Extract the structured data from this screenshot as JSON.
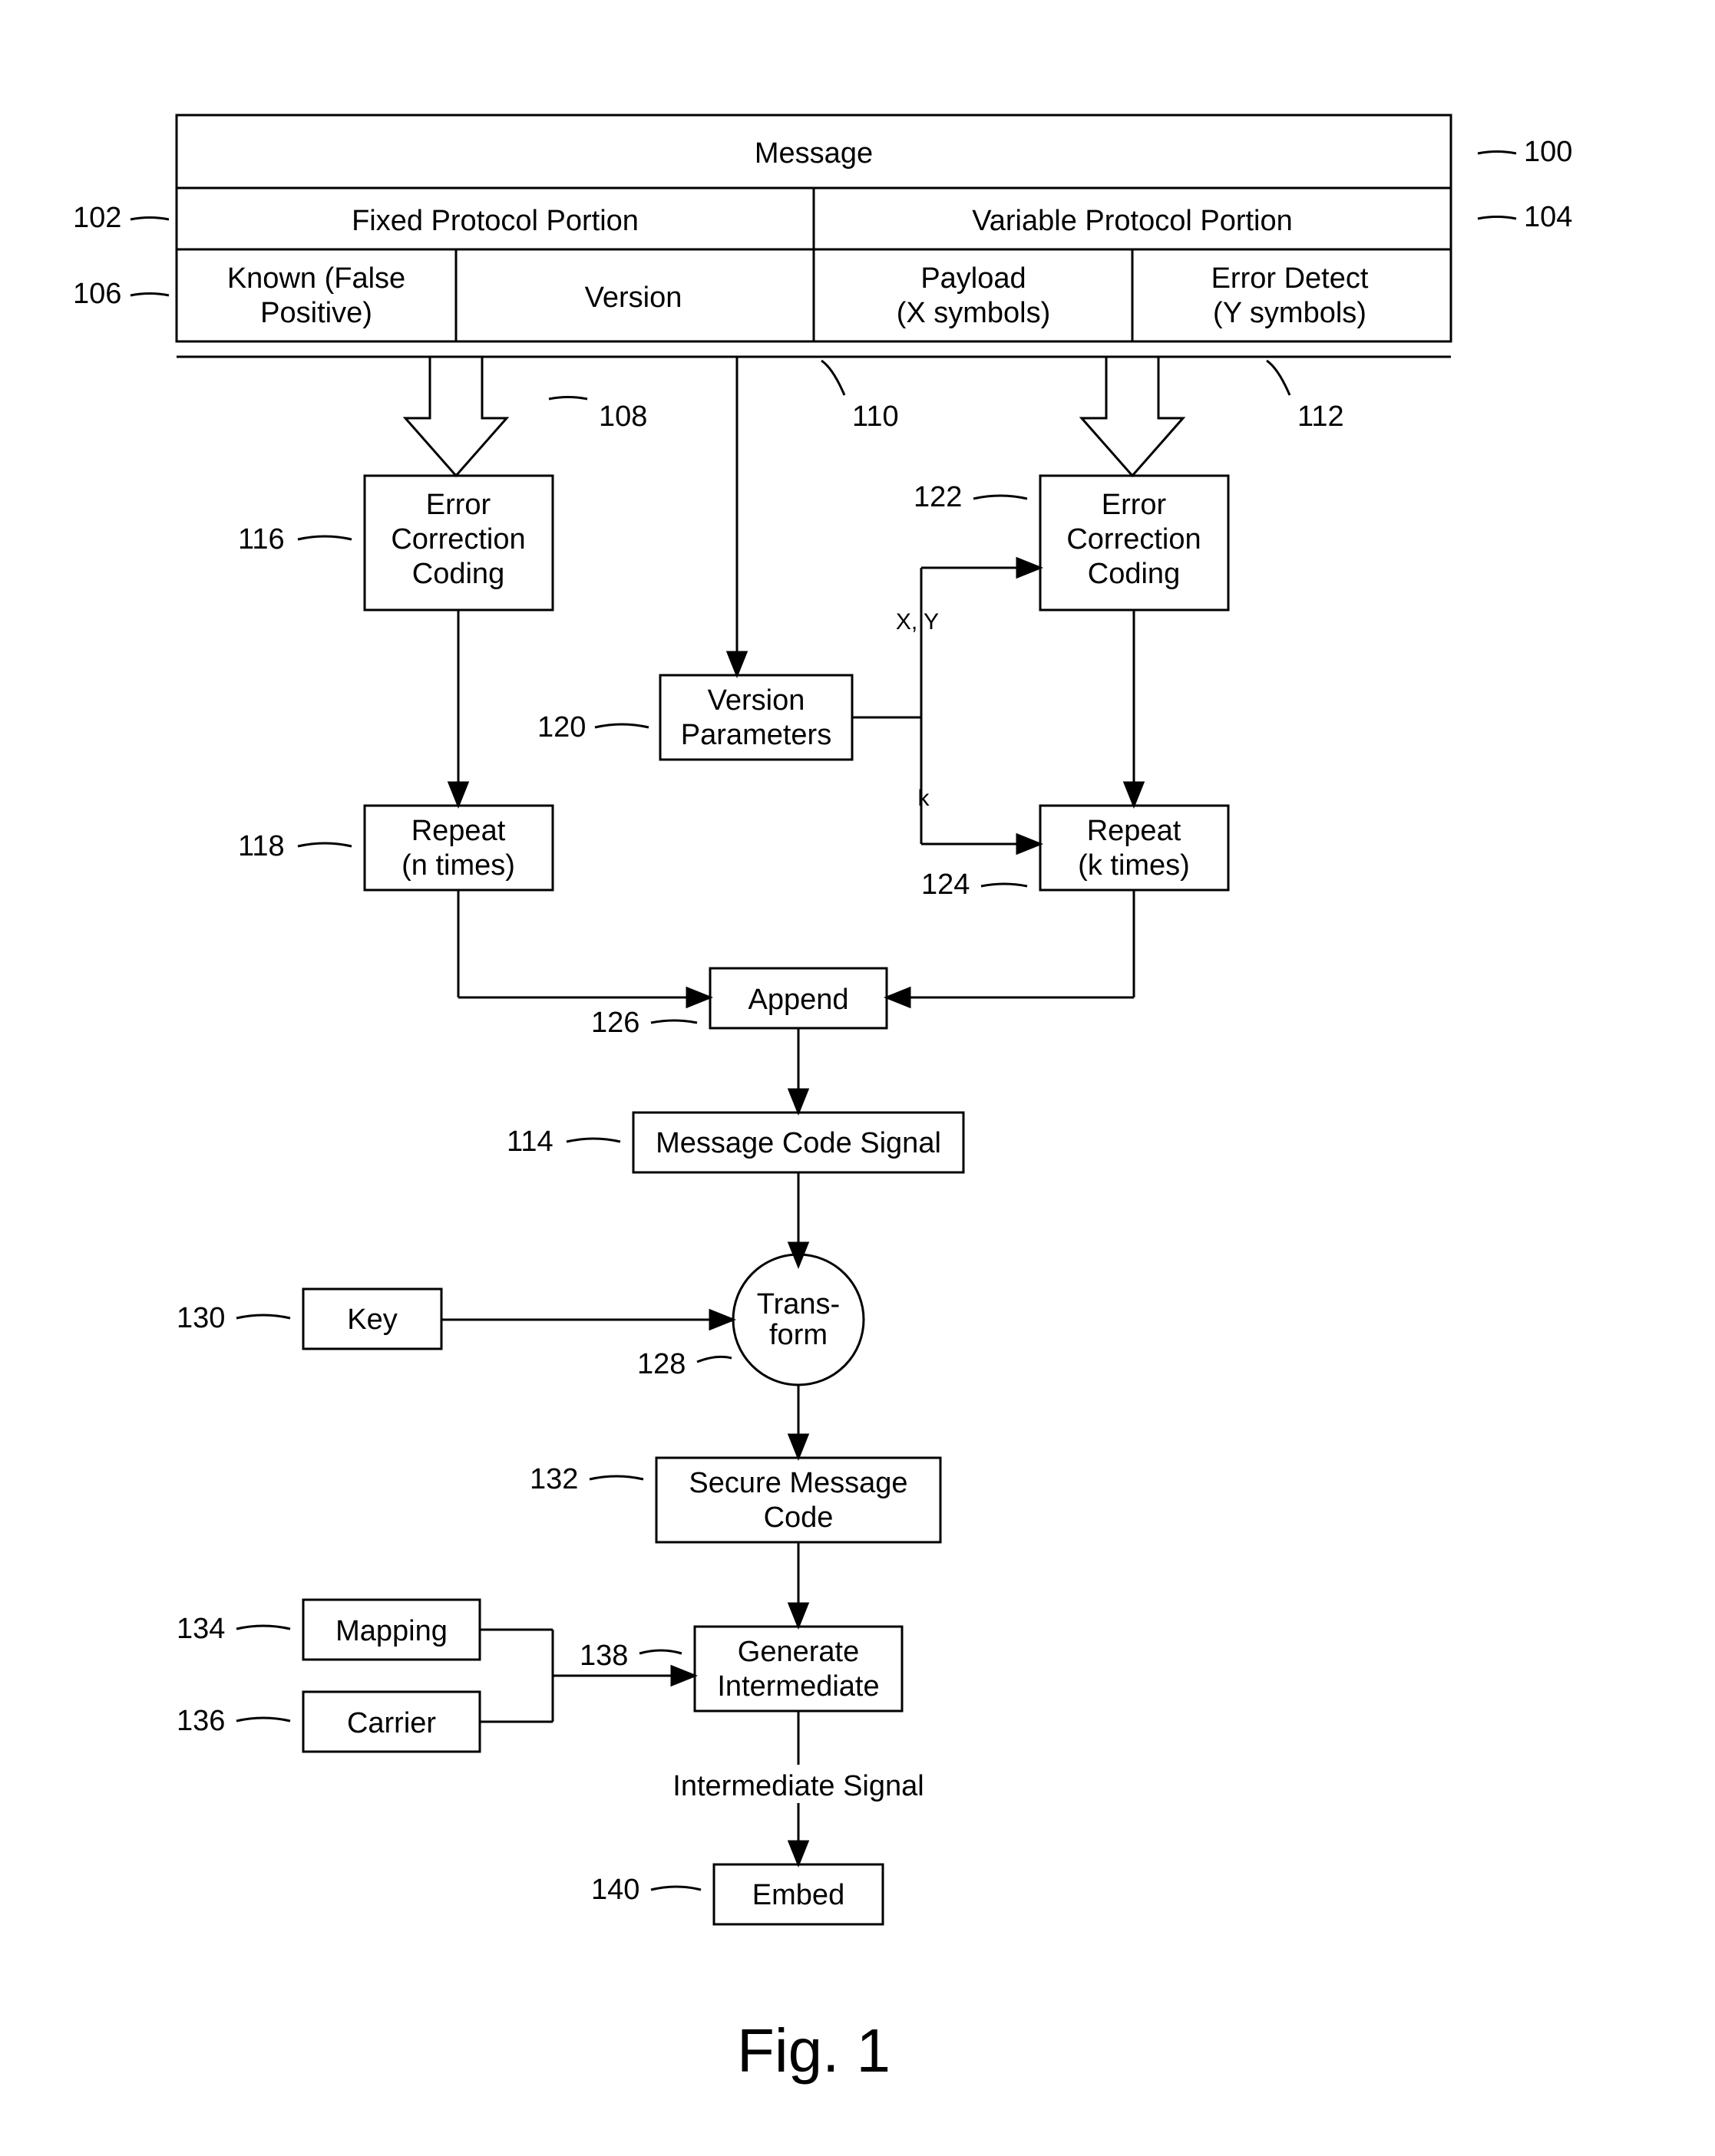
{
  "figure_label": "Fig. 1",
  "header": {
    "message": "Message",
    "fixed": "Fixed Protocol Portion",
    "variable": "Variable Protocol Portion",
    "known_l1": "Known (False",
    "known_l2": "Positive)",
    "version": "Version",
    "payload_l1": "Payload",
    "payload_l2": "(X symbols)",
    "error_l1": "Error Detect",
    "error_l2": "(Y symbols)"
  },
  "boxes": {
    "ecc1_l1": "Error",
    "ecc1_l2": "Correction",
    "ecc1_l3": "Coding",
    "vp_l1": "Version",
    "vp_l2": "Parameters",
    "ecc2_l1": "Error",
    "ecc2_l2": "Correction",
    "ecc2_l3": "Coding",
    "repeat1_l1": "Repeat",
    "repeat1_l2": "(n times)",
    "repeat2_l1": "Repeat",
    "repeat2_l2": "(k times)",
    "append": "Append",
    "mcs": "Message Code Signal",
    "key": "Key",
    "trans_l1": "Trans-",
    "trans_l2": "form",
    "smc_l1": "Secure Message",
    "smc_l2": "Code",
    "mapping": "Mapping",
    "carrier": "Carrier",
    "gi_l1": "Generate",
    "gi_l2": "Intermediate",
    "intsig": "Intermediate Signal",
    "embed": "Embed"
  },
  "nums": {
    "n100": "100",
    "n102": "102",
    "n104": "104",
    "n106": "106",
    "n108": "108",
    "n110": "110",
    "n112": "112",
    "n114": "114",
    "n116": "116",
    "n118": "118",
    "n120": "120",
    "n122": "122",
    "n124": "124",
    "n126": "126",
    "n128": "128",
    "n130": "130",
    "n132": "132",
    "n134": "134",
    "n136": "136",
    "n138": "138",
    "n140": "140"
  },
  "conn": {
    "xy": "X, Y",
    "k": "k"
  }
}
